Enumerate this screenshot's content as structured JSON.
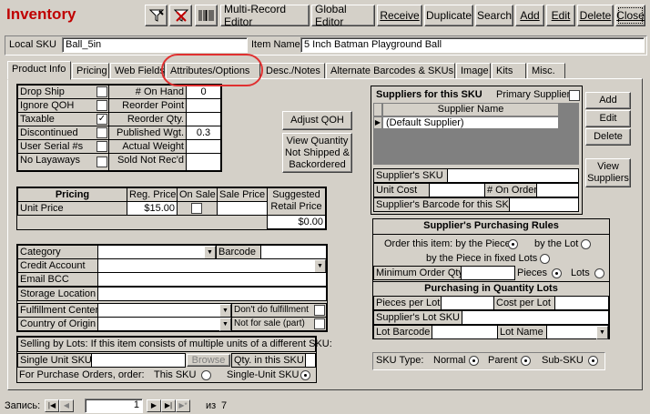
{
  "window": {
    "title": "Inventory"
  },
  "toolbar": {
    "multi_record_editor": "Multi-Record Editor",
    "global_editor": "Global Editor",
    "receive": "Receive",
    "duplicate": "Duplicate",
    "search": "Search",
    "add": "Add",
    "edit": "Edit",
    "delete": "Delete",
    "close": "Close"
  },
  "header": {
    "local_sku_label": "Local SKU",
    "local_sku_value": "Ball_5in",
    "item_name_label": "Item Name",
    "item_name_value": "5 Inch Batman Playground Ball"
  },
  "tabs": [
    "Product Info",
    "Pricing",
    "Web Fields",
    "Attributes/Options",
    "Desc./Notes",
    "Alternate Barcodes & SKUs",
    "Image",
    "Kits",
    "Misc."
  ],
  "flags": [
    {
      "label": "Drop Ship",
      "checked": false
    },
    {
      "label": "Ignore QOH",
      "checked": false
    },
    {
      "label": "Taxable",
      "checked": true
    },
    {
      "label": "Discontinued",
      "checked": false
    },
    {
      "label": "User Serial #s",
      "checked": false
    },
    {
      "label": "No Layaways",
      "checked": false
    }
  ],
  "stock": [
    {
      "label": "# On Hand",
      "value": "0"
    },
    {
      "label": "Reorder Point",
      "value": ""
    },
    {
      "label": "Reorder Qty.",
      "value": ""
    },
    {
      "label": "Published Wgt.",
      "value": "0.3"
    },
    {
      "label": "Actual Weight",
      "value": ""
    },
    {
      "label": "Sold Not Rec'd",
      "value": ""
    }
  ],
  "buttons": {
    "adjust_qoh": "Adjust QOH",
    "view_qty_1": "View Quantity",
    "view_qty_2": "Not Shipped &",
    "view_qty_3": "Backordered"
  },
  "pricing": {
    "header": "Pricing",
    "reg_price_label": "Reg. Price",
    "on_sale_label": "On Sale",
    "sale_price_label": "Sale Price",
    "suggested_1": "Suggested",
    "suggested_2": "Retail Price",
    "unit_price_label": "Unit Price",
    "reg_price": "$15.00",
    "suggested_value": "$0.00"
  },
  "details": {
    "category": "Category",
    "barcode": "Barcode",
    "credit_account": "Credit Account",
    "email_bcc": "Email BCC",
    "storage_location": "Storage Location",
    "fulfillment_center": "Fulfillment Center",
    "dont_fulfill": "Don't do fulfillment",
    "country_of_origin": "Country of Origin",
    "not_for_sale": "Not for sale (part)"
  },
  "lots": {
    "desc": "Selling by Lots: If this item consists of multiple units of a different SKU:",
    "single_unit_sku": "Single Unit SKU",
    "browse": "Browse",
    "qty_in_sku": "Qty. in this SKU",
    "po_order": "For Purchase Orders, order:",
    "this_sku": "This SKU",
    "single_unit": "Single-Unit SKU"
  },
  "suppliers": {
    "title": "Suppliers for this SKU",
    "primary": "Primary Supplier",
    "col": "Supplier Name",
    "row": "(Default Supplier)",
    "add": "Add",
    "edit": "Edit",
    "delete": "Delete",
    "view_1": "View",
    "view_2": "Suppliers",
    "sku_label": "Supplier's SKU",
    "unit_cost": "Unit Cost",
    "on_order": "# On Order",
    "barcode_label": "Supplier's Barcode for this SKU"
  },
  "rules": {
    "title": "Supplier's Purchasing Rules",
    "order_by": "Order this item: by the Piece",
    "by_lot": "by the Lot",
    "fixed_lots": "by the Piece in fixed Lots",
    "min_qty": "Minimum Order Qty.",
    "pieces": "Pieces",
    "lots": "Lots",
    "qty_title": "Purchasing in Quantity Lots",
    "pieces_per_lot": "Pieces per Lot",
    "cost_per_lot": "Cost per Lot",
    "lot_sku": "Supplier's Lot SKU",
    "lot_barcode": "Lot Barcode",
    "lot_name": "Lot Name"
  },
  "sku_type": {
    "label": "SKU Type:",
    "normal": "Normal",
    "parent": "Parent",
    "sub": "Sub-SKU"
  },
  "nav": {
    "label": "Запись:",
    "current": "1",
    "of": "из",
    "total": "7"
  },
  "colors": {
    "title": "#c00000",
    "highlight": "#e03030"
  }
}
